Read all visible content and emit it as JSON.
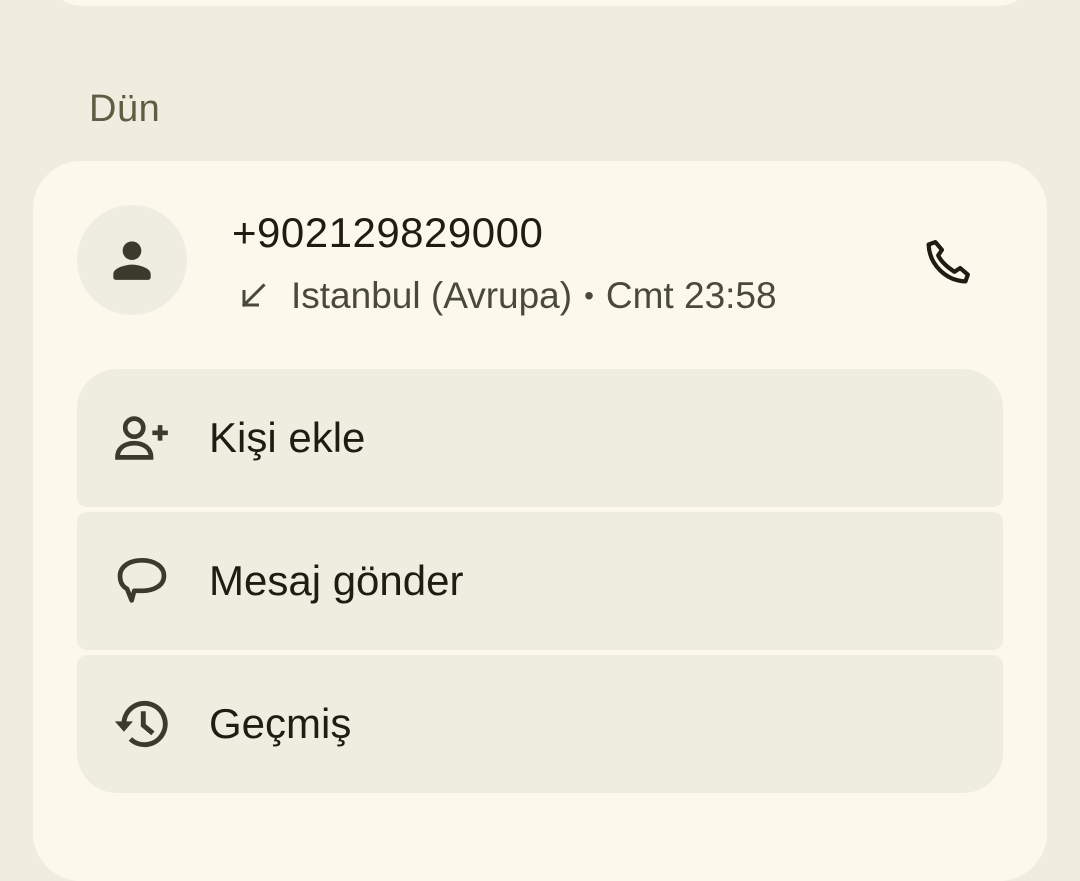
{
  "section": {
    "header": "Dün"
  },
  "call_entry": {
    "number": "+902129829000",
    "direction_icon": "incoming-call-arrow-icon",
    "location": "Istanbul (Avrupa)",
    "separator": "•",
    "time": "Cmt 23:58",
    "avatar_icon": "person-icon",
    "call_icon": "phone-icon"
  },
  "actions": [
    {
      "label": "Kişi ekle",
      "icon": "add-person-icon"
    },
    {
      "label": "Mesaj gönder",
      "icon": "message-bubble-icon"
    },
    {
      "label": "Geçmiş",
      "icon": "history-icon"
    }
  ],
  "colors": {
    "background": "#f0ede0",
    "card": "#fcf8ec",
    "action_bg": "#efede0",
    "text_primary": "#1e1c13",
    "text_secondary": "#4a4a3a",
    "header_text": "#5f5e43"
  }
}
